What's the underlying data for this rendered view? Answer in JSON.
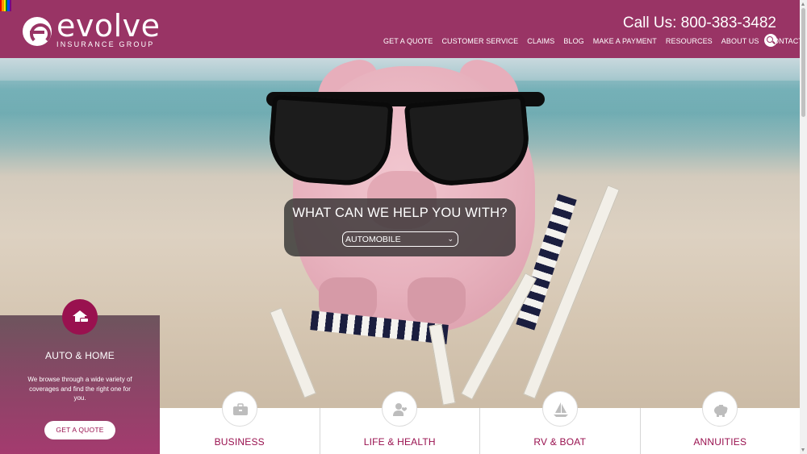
{
  "brand": {
    "name": "evolve",
    "subtitle": "INSURANCE GROUP",
    "accent_color": "#993465",
    "dark_accent": "#99114f"
  },
  "header": {
    "phone": "Call Us: 800-383-3482",
    "nav": [
      {
        "label": "GET A QUOTE"
      },
      {
        "label": "CUSTOMER SERVICE"
      },
      {
        "label": "CLAIMS"
      },
      {
        "label": "BLOG"
      },
      {
        "label": "MAKE A PAYMENT"
      },
      {
        "label": "RESOURCES"
      },
      {
        "label": "ABOUT US"
      },
      {
        "label": "CONTACT"
      }
    ],
    "search_icon": "search-icon"
  },
  "hero": {
    "question": "WHAT CAN WE HELP YOU WITH?",
    "select_value": "AUTOMOBILE"
  },
  "featured": {
    "icon": "house-car-icon",
    "title": "AUTO & HOME",
    "description": "We browse through a wide variety of coverages and find the right one for you.",
    "button": "GET A QUOTE"
  },
  "categories": [
    {
      "label": "BUSINESS",
      "icon": "briefcase-icon"
    },
    {
      "label": "LIFE & HEALTH",
      "icon": "person-heart-icon"
    },
    {
      "label": "RV & BOAT",
      "icon": "sailboat-icon"
    },
    {
      "label": "ANNUITIES",
      "icon": "piggy-bank-icon"
    }
  ]
}
